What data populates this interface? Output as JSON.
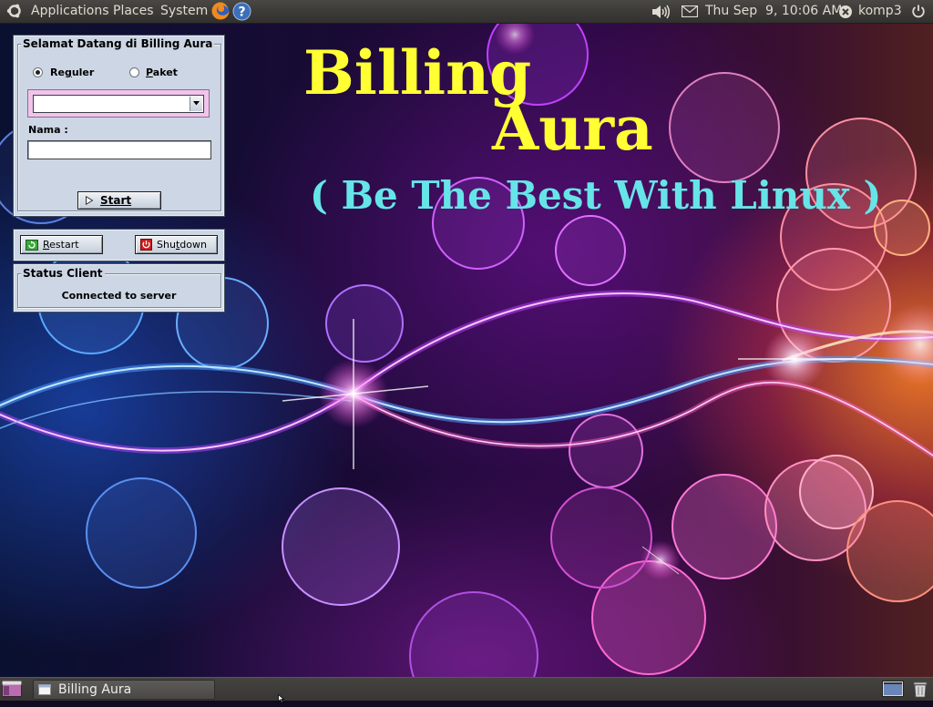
{
  "top_panel": {
    "menus": [
      "Applications",
      "Places",
      "System"
    ],
    "clock": "Thu Sep  9, 10:06 AM",
    "user": "komp3"
  },
  "desktop": {
    "title_line1": "Billing",
    "title_line2": "Aura",
    "tagline": "( Be The Best With Linux )",
    "colors": {
      "title": "#ffff33",
      "tagline": "#66e5e8"
    }
  },
  "login_window": {
    "group_title": "Selamat Datang di Billing Aura",
    "radio_reguler": "Reguler",
    "radio_paket": "Paket",
    "selected_mode": "Reguler",
    "dropdown_value": "",
    "name_label": "Nama :",
    "name_value": "",
    "start_button": "Start"
  },
  "power_window": {
    "restart_button": "Restart",
    "shutdown_button": "Shutdown"
  },
  "status_window": {
    "group_title": "Status Client",
    "status_text": "Connected to server"
  },
  "bottom_panel": {
    "task_label": "Billing Aura"
  }
}
